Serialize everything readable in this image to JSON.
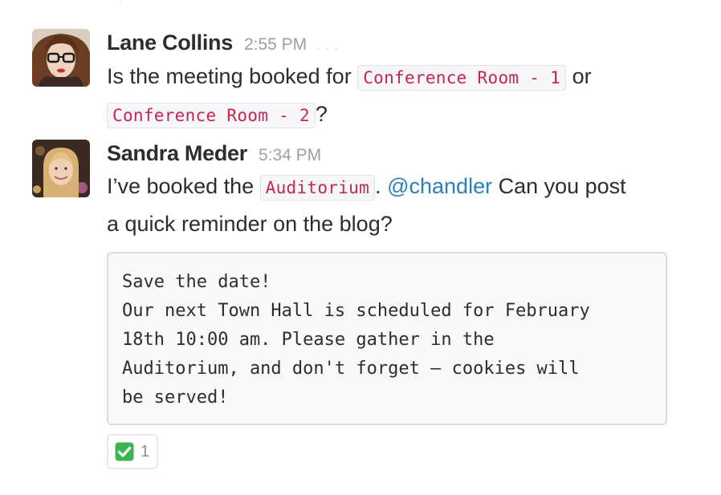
{
  "messages": [
    {
      "author": "Lane Collins",
      "time": "2:55 PM",
      "text_parts": {
        "p1": "Is the meeting booked for ",
        "code1": "Conference Room - 1",
        "p2": " or",
        "code2": "Conference Room - 2",
        "p3": "?"
      },
      "header_extra": "..."
    },
    {
      "author": "Sandra Meder",
      "time": "5:34 PM",
      "text_parts": {
        "p1": "I’ve booked the ",
        "code1": "Auditorium",
        "p2": ". ",
        "mention": "@chandler",
        "p3": " Can you post a quick reminder on the blog?"
      },
      "preformatted": "Save the date!\nOur next Town Hall is scheduled for February\n18th 10:00 am. Please gather in the\nAuditorium, and don't forget – cookies will\nbe served!",
      "reactions": [
        {
          "emoji": "white-check-mark",
          "count": "1"
        }
      ]
    }
  ],
  "colors": {
    "code_text": "#c7254e",
    "mention": "#2a80b9",
    "timestamp": "#9e9ea6",
    "reaction_check": "#3fb34f"
  }
}
